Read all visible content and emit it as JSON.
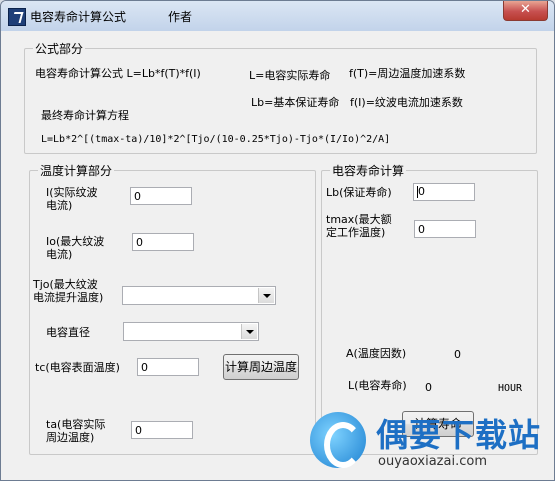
{
  "window": {
    "title": "电容寿命计算公式",
    "author_label": "作者",
    "close_symbol": "✕"
  },
  "formula_group": {
    "legend": "公式部分",
    "formula1": "电容寿命计算公式 L=Lb*f(T)*f(I)",
    "def_L": "L=电容实际寿命",
    "def_fT": "f(T)=周边温度加速系数",
    "def_Lb": "Lb=基本保证寿命",
    "def_fI": "f(I)=纹波电流加速系数",
    "final_label": "最终寿命计算方程",
    "final_eq": "L=Lb*2^[(tmax-ta)/10]*2^[Tjo/(10-0.25*Tjo)-Tjo*(I/Io)^2/A]"
  },
  "temp_group": {
    "legend": "温度计算部分",
    "i_label": "I(实际纹波\n电流)",
    "i_value": "0",
    "io_label": "Io(最大纹波\n电流)",
    "io_value": "0",
    "tjo_label": "Tjo(最大纹波\n电流提升温度)",
    "tjo_value": "",
    "diameter_label": "电容直径",
    "diameter_value": "",
    "tc_label": "tc(电容表面温度)",
    "tc_value": "0",
    "calc_temp_button": "计算周边温度",
    "ta_label": "ta(电容实际\n周边温度)",
    "ta_value": "0"
  },
  "life_group": {
    "legend": "电容寿命计算",
    "lb_label": "Lb(保证寿命)",
    "lb_value": "0",
    "tmax_label": "tmax(最大额\n定工作温度)",
    "tmax_value": "0",
    "a_label": "A(温度因数)",
    "a_value": "0",
    "l_label": "L(电容寿命)",
    "l_value": "0",
    "unit": "HOUR",
    "calc_life_button": "计算寿命"
  },
  "watermark": {
    "title": "偶要下载站",
    "url": "ouyaoxiazai.com"
  },
  "colors": {
    "accent": "#1d6fc4",
    "close_button": "#c75050"
  }
}
